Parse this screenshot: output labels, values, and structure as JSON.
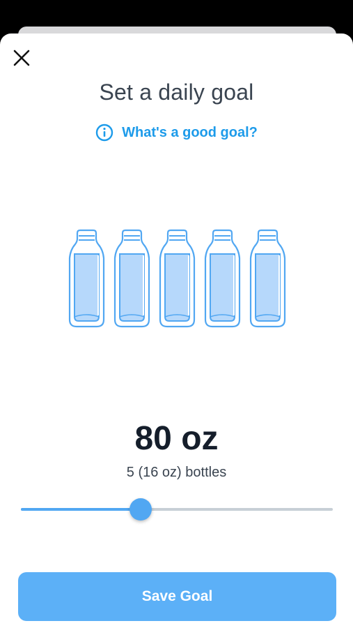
{
  "header": {
    "close_icon": "close-icon",
    "title": "Set a daily goal",
    "help_link": "What's a good goal?",
    "help_icon": "info-icon"
  },
  "bottles": {
    "count": 5,
    "icon": "water-bottle-icon"
  },
  "goal": {
    "amount": "80 oz",
    "description": "5 (16 oz) bottles"
  },
  "slider": {
    "value_fraction": 0.385
  },
  "actions": {
    "save_label": "Save Goal"
  },
  "colors": {
    "accent": "#1d9bea",
    "slider_fill": "#51a7f2",
    "button": "#5cb0f7",
    "bottle_stroke": "#51a7f2",
    "bottle_water": "#b6d8fb",
    "title_text": "#3a4450",
    "amount_text": "#151e2b"
  }
}
